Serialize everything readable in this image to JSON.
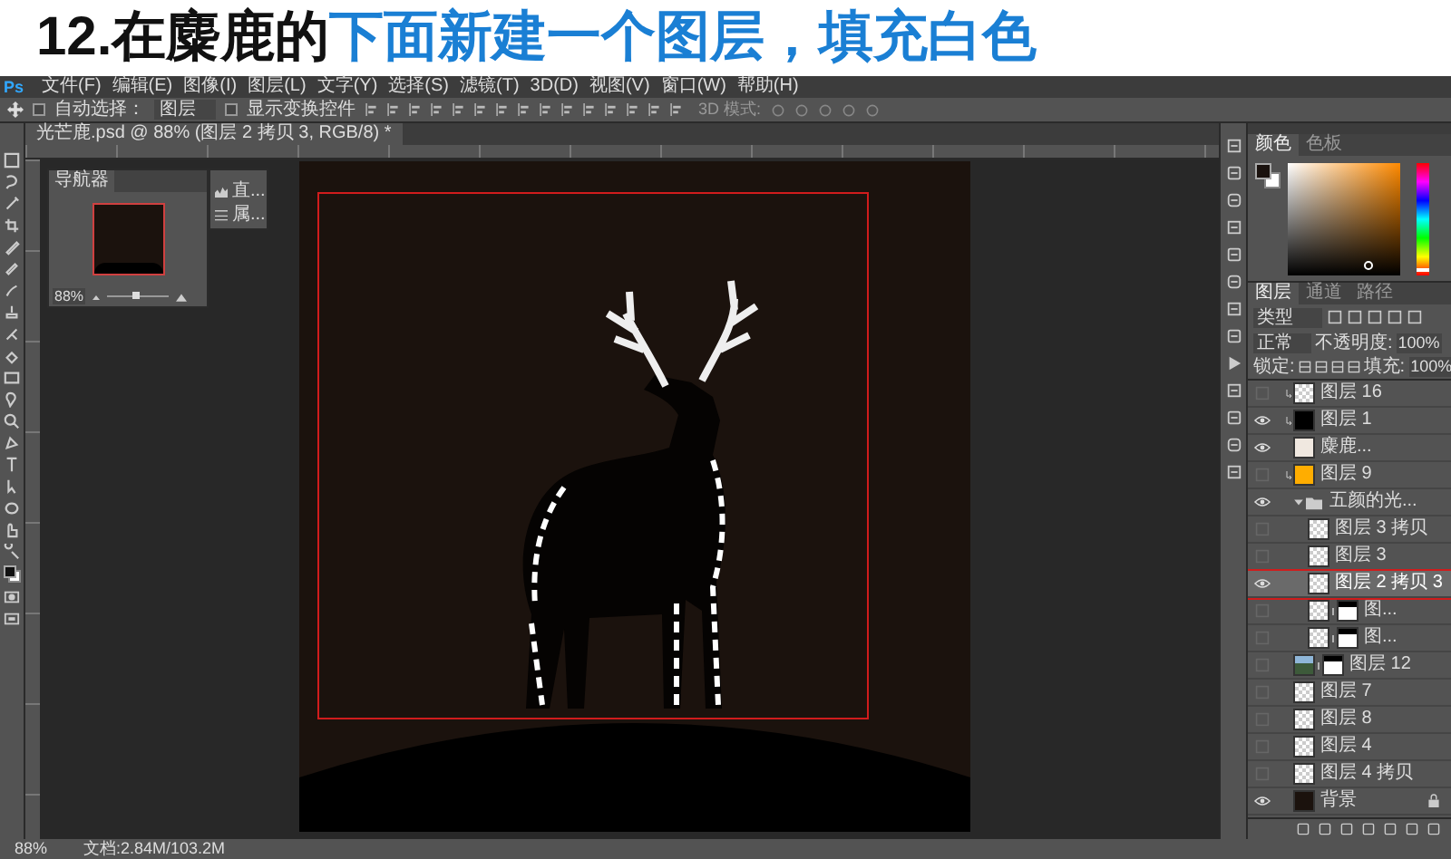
{
  "heading": {
    "prefix": "12.在麋鹿的",
    "highlight": "下面新建一个图层，填充白色"
  },
  "app": {
    "logo": "Ps"
  },
  "menu": [
    "文件(F)",
    "编辑(E)",
    "图像(I)",
    "图层(L)",
    "文字(Y)",
    "选择(S)",
    "滤镜(T)",
    "3D(D)",
    "视图(V)",
    "窗口(W)",
    "帮助(H)"
  ],
  "options_bar": {
    "auto_select_label": "自动选择：",
    "auto_select_checked": false,
    "target": "图层",
    "show_transform_label": "显示变换控件",
    "show_transform_checked": false,
    "mode_3d": "3D 模式:"
  },
  "document_tab": {
    "title": "光芒鹿.psd @ 88% (图层 2 拷贝 3, RGB/8) *"
  },
  "navigator": {
    "title": "导航器",
    "zoom": "88%",
    "level": 0.45
  },
  "mini_panel": {
    "items": [
      "直...",
      "属..."
    ]
  },
  "color_panel": {
    "tabs": [
      {
        "label": "颜色",
        "selected": true
      },
      {
        "label": "色板",
        "selected": false
      }
    ],
    "hue_slider": {
      "level": 0.04
    }
  },
  "layers_panel": {
    "tabs": [
      {
        "label": "图层",
        "selected": true
      },
      {
        "label": "通道",
        "selected": false
      },
      {
        "label": "路径",
        "selected": false
      }
    ],
    "filter": "类型",
    "blend_mode": "正常",
    "opacity_label": "不透明度:",
    "opacity": "100%",
    "lock_label": "锁定:",
    "fill_label": "填充:",
    "fill": "100%",
    "layers": [
      {
        "kind": "layer",
        "name": "图层 16",
        "visible": false,
        "selected": false,
        "clipped": true,
        "mask": false,
        "locked": false,
        "thumbnail": {
          "kind": "transparent"
        }
      },
      {
        "kind": "layer",
        "name": "图层 1",
        "visible": true,
        "selected": false,
        "clipped": true,
        "mask": false,
        "locked": false,
        "thumbnail": {
          "kind": "black"
        }
      },
      {
        "kind": "layer",
        "name": "麋鹿...",
        "visible": true,
        "selected": false,
        "clipped": false,
        "mask": false,
        "locked": false,
        "thumbnail": {
          "kind": "deer"
        }
      },
      {
        "kind": "layer",
        "name": "图层 9",
        "visible": false,
        "selected": false,
        "clipped": true,
        "mask": false,
        "locked": false,
        "thumbnail": {
          "kind": "orange"
        }
      },
      {
        "kind": "group",
        "name": "五颜的光...",
        "visible": true,
        "selected": false,
        "clipped": false,
        "mask": false,
        "locked": false,
        "expanded": true,
        "children": [
          {
            "kind": "layer",
            "name": "图层 3 拷贝",
            "visible": false,
            "selected": false,
            "clipped": false,
            "mask": false,
            "locked": false,
            "thumbnail": {
              "kind": "transparent"
            }
          },
          {
            "kind": "layer",
            "name": "图层 3",
            "visible": false,
            "selected": false,
            "clipped": false,
            "mask": false,
            "locked": false,
            "thumbnail": {
              "kind": "transparent"
            }
          },
          {
            "kind": "layer",
            "name": "图层 2 拷贝 3",
            "visible": true,
            "selected": true,
            "clipped": false,
            "mask": false,
            "locked": false,
            "thumbnail": {
              "kind": "transparent"
            }
          },
          {
            "kind": "layer",
            "name": "图...",
            "visible": false,
            "selected": false,
            "clipped": false,
            "mask": true,
            "locked": false,
            "thumbnail": {
              "kind": "transparent"
            }
          },
          {
            "kind": "layer",
            "name": "图...",
            "visible": false,
            "selected": false,
            "clipped": false,
            "mask": true,
            "locked": false,
            "thumbnail": {
              "kind": "transparent"
            }
          }
        ]
      },
      {
        "kind": "layer",
        "name": "图层 12",
        "visible": false,
        "selected": false,
        "clipped": false,
        "mask": true,
        "locked": false,
        "thumbnail": {
          "kind": "photo"
        }
      },
      {
        "kind": "layer",
        "name": "图层 7",
        "visible": false,
        "selected": false,
        "clipped": false,
        "mask": false,
        "locked": false,
        "thumbnail": {
          "kind": "transparent"
        }
      },
      {
        "kind": "layer",
        "name": "图层 8",
        "visible": false,
        "selected": false,
        "clipped": false,
        "mask": false,
        "locked": false,
        "thumbnail": {
          "kind": "transparent"
        }
      },
      {
        "kind": "layer",
        "name": "图层 4",
        "visible": false,
        "selected": false,
        "clipped": false,
        "mask": false,
        "locked": false,
        "thumbnail": {
          "kind": "transparent"
        }
      },
      {
        "kind": "layer",
        "name": "图层 4 拷贝",
        "visible": false,
        "selected": false,
        "clipped": false,
        "mask": false,
        "locked": false,
        "thumbnail": {
          "kind": "transparent"
        }
      },
      {
        "kind": "background",
        "name": "背景",
        "visible": true,
        "selected": false,
        "clipped": false,
        "mask": false,
        "locked": true,
        "thumbnail": {
          "kind": "dark"
        }
      }
    ]
  },
  "status_bar": {
    "zoom": "88%",
    "doc_size": "文档:2.84M/103.2M"
  }
}
